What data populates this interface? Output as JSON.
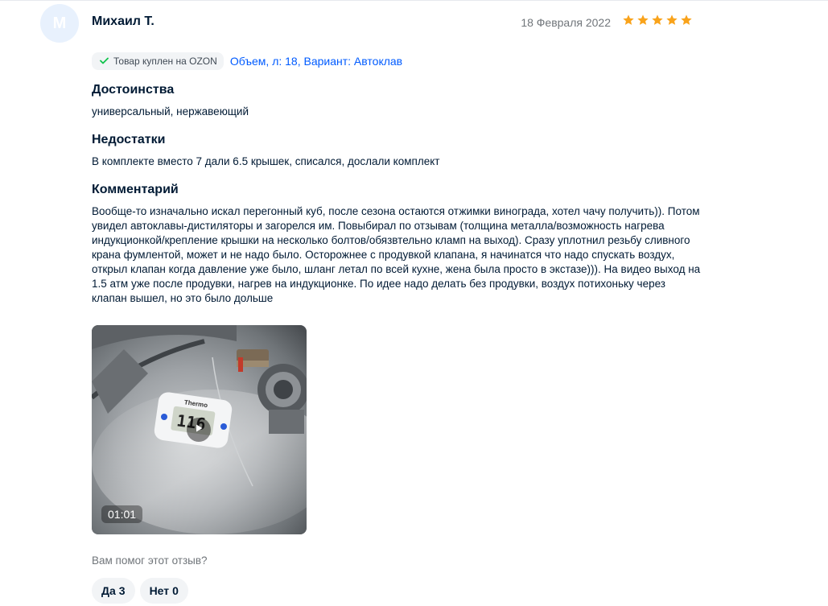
{
  "review": {
    "avatar_letter": "М",
    "author": "Михаил Т.",
    "date": "18 Февраля 2022",
    "rating": 5,
    "purchase_badge": "Товар куплен на OZON",
    "variant": "Объем, л: 18, Вариант: Автоклав",
    "pros_title": "Достоинства",
    "pros_text": "универсальный, нержавеющий",
    "cons_title": "Недостатки",
    "cons_text": "В комплекте вместо 7 дали 6.5 крышек, списался, дослали комплект",
    "comment_title": "Комментарий",
    "comment_text": "Вообще-то изначально искал перегонный куб, после сезона остаются отжимки винограда, хотел чачу получить)). Потом увидел автоклавы-дистиляторы и загорелся им. Повыбирал по отзывам (толщина металла/возможность нагрева индукционкой/крепление крышки на несколько болтов/обязвтельно кламп на выход). Сразу уплотнил резьбу сливного крана фумлентой, может и не надо было. Осторожнее с продувкой клапана, я начинатся что надо спускать воздух, открыл клапан когда давление уже было, шланг летал по всей кухне, жена была просто в экстазе))). На видео выход на 1.5 атм уже после продувки, нагрев на индукционке. По идее надо делать без продувки, воздух потихоньку через клапан вышел, но это было дольше",
    "video_duration": "01:01",
    "thermometer_brand": "Thermo",
    "thermometer_reading": "116",
    "helpful_question": "Вам помог этот отзыв?",
    "vote_yes_label": "Да",
    "vote_yes_count": "3",
    "vote_no_label": "Нет",
    "vote_no_count": "0"
  },
  "colors": {
    "star": "#f9a31b",
    "link": "#005bff",
    "check": "#10c44c",
    "avatar_bg": "#e8f1fd"
  },
  "icons": {
    "star": "star-icon",
    "check": "check-icon",
    "play": "play-icon"
  }
}
